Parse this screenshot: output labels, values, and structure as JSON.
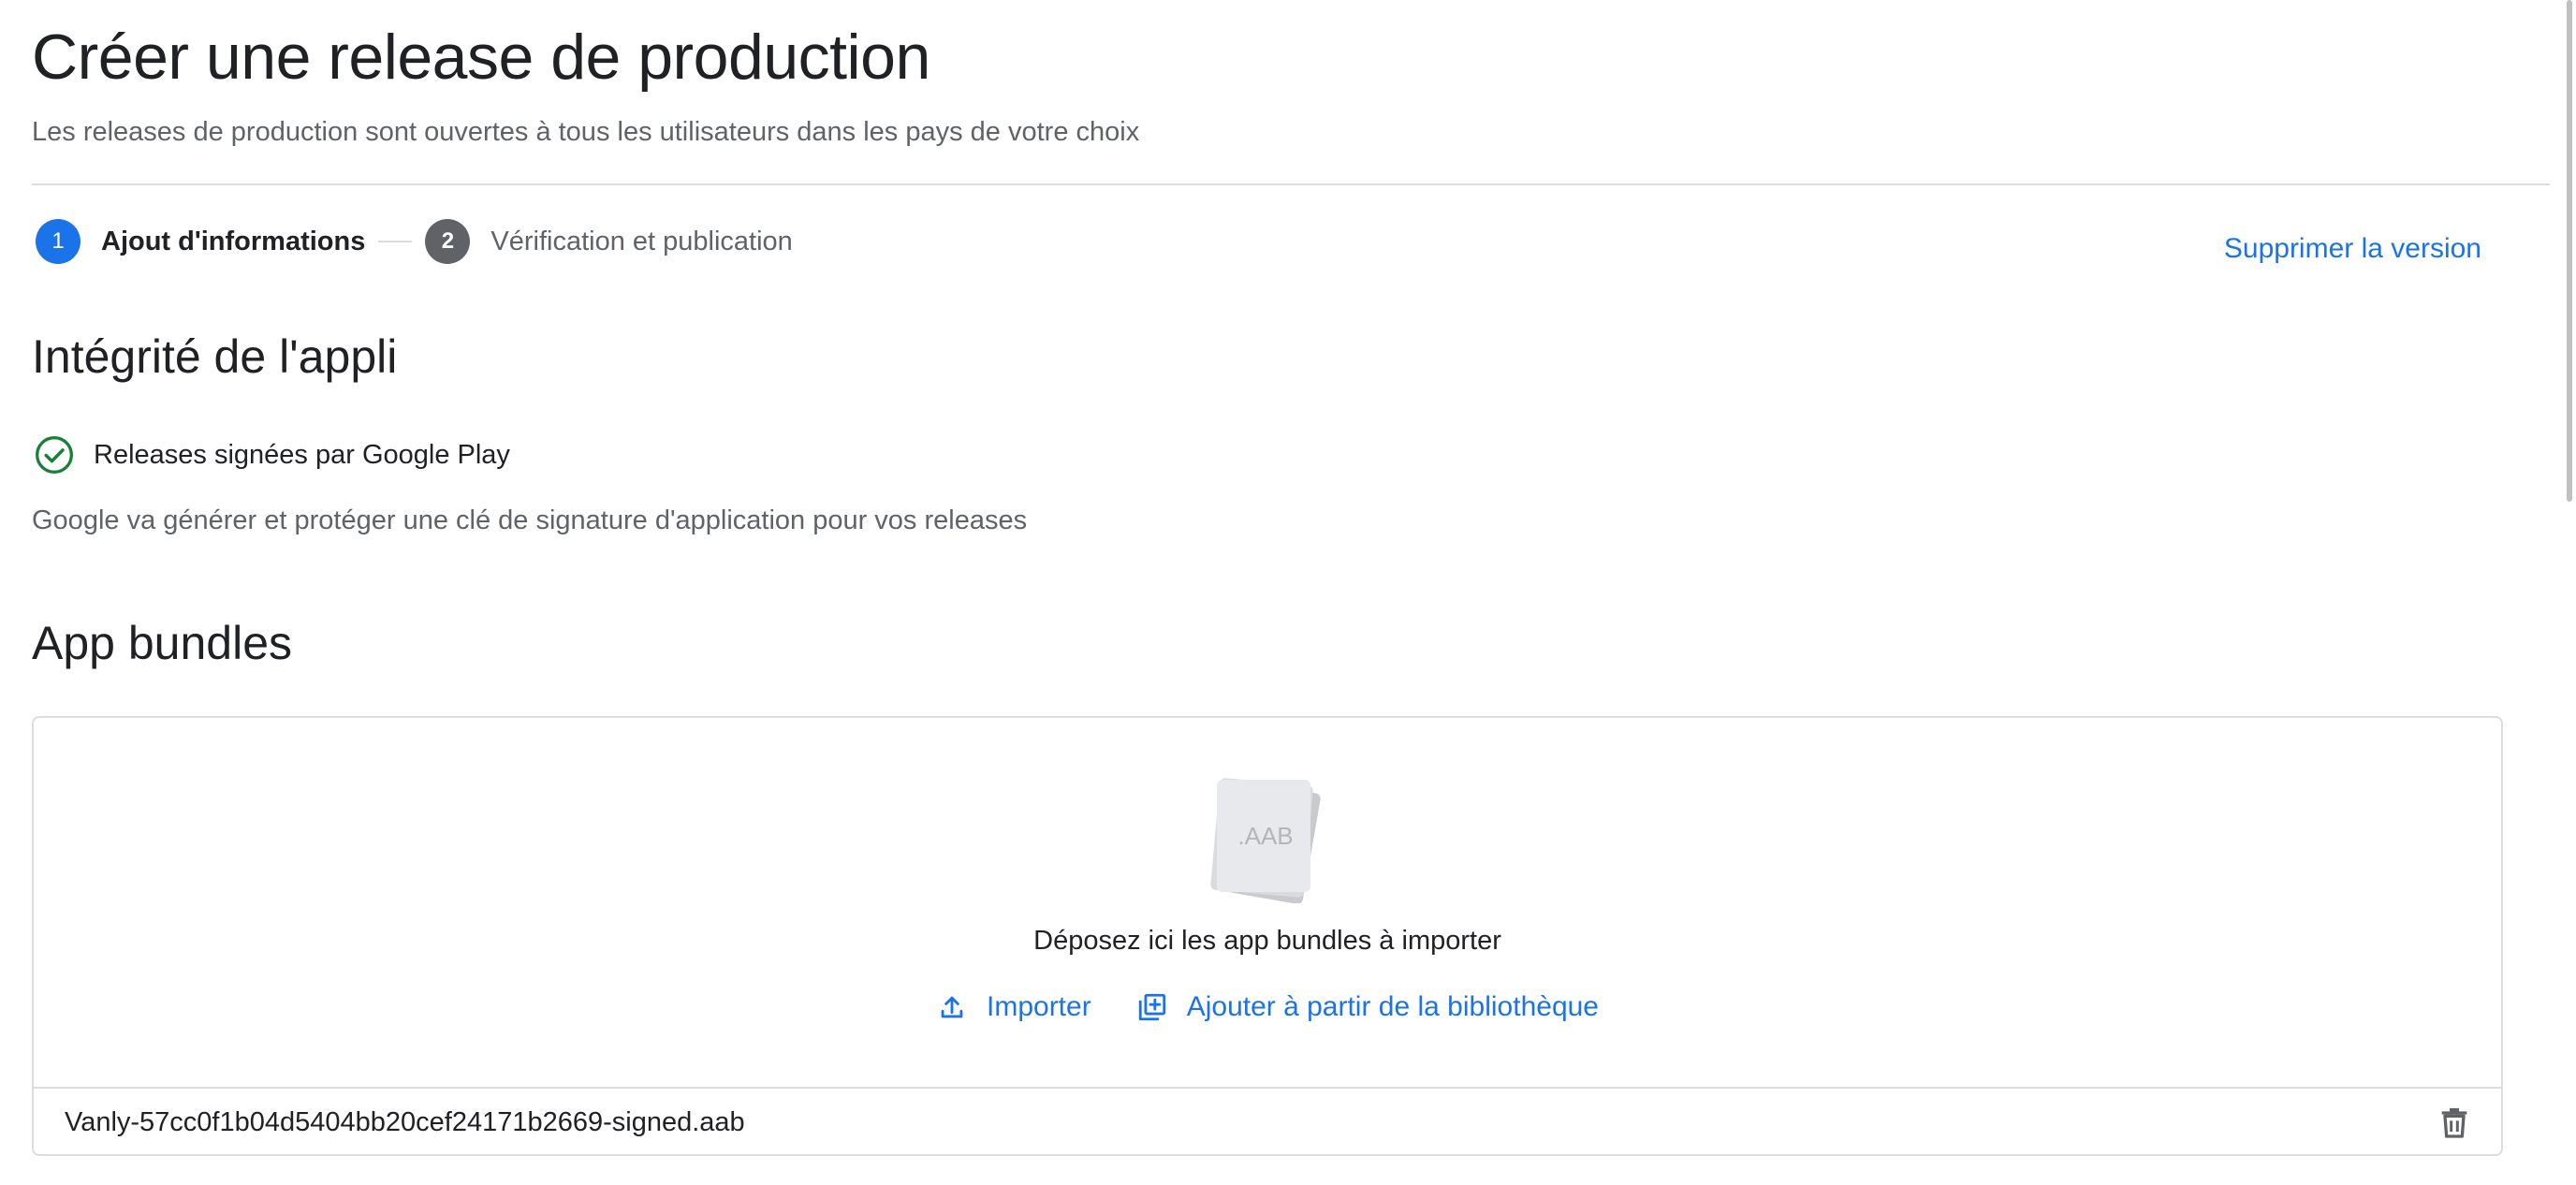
{
  "header": {
    "title": "Créer une release de production",
    "subtitle": "Les releases de production sont ouvertes à tous les utilisateurs dans les pays de votre choix"
  },
  "stepper": {
    "steps": [
      {
        "number": "1",
        "label": "Ajout d'informations",
        "state": "active"
      },
      {
        "number": "2",
        "label": "Vérification et publication",
        "state": "inactive"
      }
    ]
  },
  "actions": {
    "delete_version": "Supprimer la version"
  },
  "integrity": {
    "title": "Intégrité de l'appli",
    "status_icon": "check-circle-icon",
    "status_label": "Releases signées par Google Play",
    "description": "Google va générer et protéger une clé de signature d'application pour vos releases"
  },
  "bundles": {
    "title": "App bundles",
    "graphic_label": ".AAB",
    "drop_text": "Déposez ici les app bundles à importer",
    "import_label": "Importer",
    "library_label": "Ajouter à partir de la bibliothèque",
    "files": [
      {
        "name": "Vanly-57cc0f1b04d5404bb20cef24171b2669-signed.aab"
      }
    ]
  },
  "colors": {
    "accent": "#1a73e8",
    "success": "#188038",
    "step_inactive": "#5f6368",
    "text_primary": "#202124",
    "text_secondary": "#5f6368",
    "divider": "#dadce0"
  }
}
